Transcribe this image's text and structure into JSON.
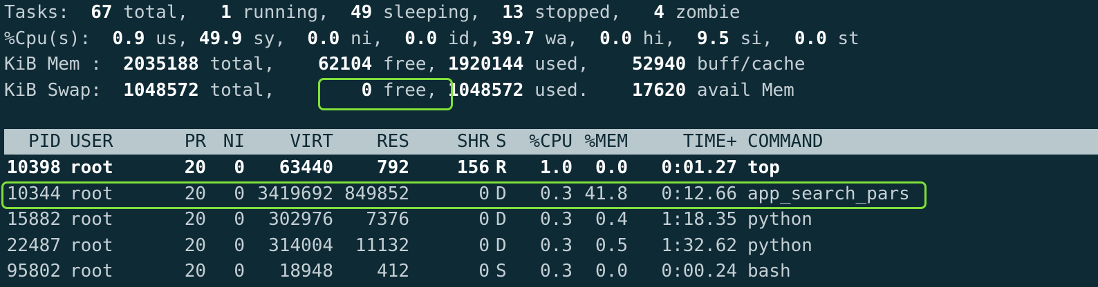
{
  "summary": {
    "tasks": {
      "label": "Tasks:",
      "total": "67",
      "total_label": "total,",
      "running": "1",
      "running_label": "running,",
      "sleeping": "49",
      "sleeping_label": "sleeping,",
      "stopped": "13",
      "stopped_label": "stopped,",
      "zombie": "4",
      "zombie_label": "zombie"
    },
    "cpu": {
      "label": "%Cpu(s):",
      "us": "0.9",
      "us_label": "us,",
      "sy": "49.9",
      "sy_label": "sy,",
      "ni": "0.0",
      "ni_label": "ni,",
      "id": "0.0",
      "id_label": "id,",
      "wa": "39.7",
      "wa_label": "wa,",
      "hi": "0.0",
      "hi_label": "hi,",
      "si": "9.5",
      "si_label": "si,",
      "st": "0.0",
      "st_label": "st"
    },
    "mem": {
      "label": "KiB Mem :",
      "total": "2035188",
      "total_label": "total,",
      "free": "62104",
      "free_label": "free,",
      "used": "1920144",
      "used_label": "used,",
      "buff": "52940",
      "buff_label": "buff/cache"
    },
    "swap": {
      "label": "KiB Swap:",
      "total": "1048572",
      "total_label": "total,",
      "free": "0",
      "free_label": "free,",
      "used": "1048572",
      "used_label": "used.",
      "avail": "17620",
      "avail_label": "avail Mem"
    }
  },
  "columns": {
    "pid": "PID",
    "user": "USER",
    "pr": "PR",
    "ni": "NI",
    "virt": "VIRT",
    "res": "RES",
    "shr": "SHR",
    "s": "S",
    "cpu": "%CPU",
    "mem": "%MEM",
    "time": "TIME+",
    "command": "COMMAND"
  },
  "processes": [
    {
      "pid": "10398",
      "user": "root",
      "pr": "20",
      "ni": "0",
      "virt": "63440",
      "res": "792",
      "shr": "156",
      "s": "R",
      "cpu": "1.0",
      "mem": "0.0",
      "time": "0:01.27",
      "command": "top"
    },
    {
      "pid": "10344",
      "user": "root",
      "pr": "20",
      "ni": "0",
      "virt": "3419692",
      "res": "849852",
      "shr": "0",
      "s": "D",
      "cpu": "0.3",
      "mem": "41.8",
      "time": "0:12.66",
      "command": "app_search_pars"
    },
    {
      "pid": "15882",
      "user": "root",
      "pr": "20",
      "ni": "0",
      "virt": "302976",
      "res": "7376",
      "shr": "0",
      "s": "D",
      "cpu": "0.3",
      "mem": "0.4",
      "time": "1:18.35",
      "command": "python"
    },
    {
      "pid": "22487",
      "user": "root",
      "pr": "20",
      "ni": "0",
      "virt": "314004",
      "res": "11132",
      "shr": "0",
      "s": "D",
      "cpu": "0.3",
      "mem": "0.5",
      "time": "1:32.62",
      "command": "python"
    },
    {
      "pid": "95802",
      "user": "root",
      "pr": "20",
      "ni": "0",
      "virt": "18948",
      "res": "412",
      "shr": "0",
      "s": "S",
      "cpu": "0.3",
      "mem": "0.0",
      "time": "0:00.24",
      "command": "bash"
    }
  ],
  "colors": {
    "background": "#0e2a35",
    "text": "#c4cfd4",
    "header_bar": "#b8c8cc",
    "highlight_box": "#7fe03a"
  }
}
